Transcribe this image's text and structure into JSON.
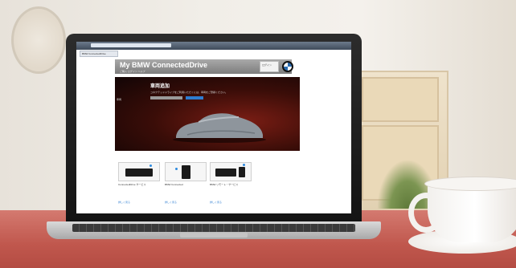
{
  "browser": {
    "tab_label": "BMW ConnectedDrive"
  },
  "site": {
    "title": "My BMW ConnectedDrive",
    "subtitle": "ご購入  ログイン  ヘルプ",
    "login_label": "ログイン"
  },
  "hero": {
    "side_label": "車両",
    "title": "車両追加",
    "text": "コネクテッドドライブをご利用いただくには、車両をご登録ください。",
    "button_primary": "",
    "button_secondary": ""
  },
  "cards": [
    {
      "title": "ConnectedDrive サービス",
      "link": "詳しく見る"
    },
    {
      "title": "BMW Connected",
      "link": "詳しく見る"
    },
    {
      "title": "BMW リモート・サービス",
      "link": "詳しく見る"
    }
  ],
  "colors": {
    "accent": "#2e7dd1",
    "hero_dark": "#3a0d08",
    "table": "#c0574d"
  }
}
